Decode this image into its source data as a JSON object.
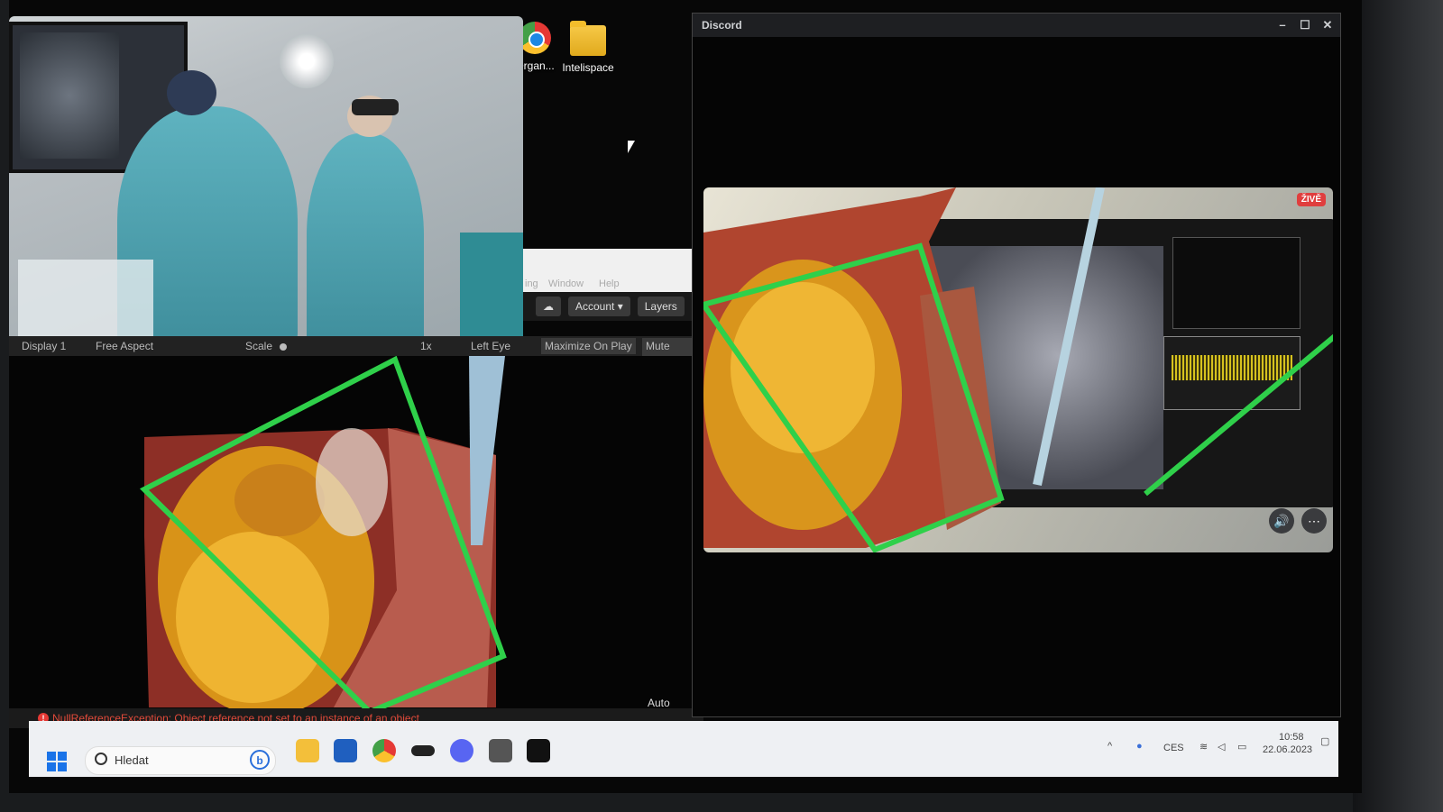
{
  "desktop": {
    "icons": [
      {
        "label": "Organ...",
        "icon": "chrome-icon"
      },
      {
        "label": "Intelispace",
        "icon": "folder-icon"
      }
    ]
  },
  "unity": {
    "menu": {
      "item1": "ing",
      "item2": "Window",
      "item3": "Help"
    },
    "toolbar": {
      "account": "Account",
      "layers": "Layers"
    },
    "game_bar": {
      "display": "Display 1",
      "aspect": "Free Aspect",
      "scale": "Scale",
      "zoom": "1x",
      "eye": "Left Eye",
      "maximize": "Maximize On Play",
      "mute": "Mute Audio"
    },
    "auto_generate": "Auto Genera",
    "error": "NullReferenceException: Object reference not set to an instance of an object"
  },
  "discord": {
    "title": "Discord",
    "live_badge": "ŽIVĚ"
  },
  "taskbar": {
    "search_placeholder": "Hledat",
    "language": "CES",
    "time": "10:58",
    "date": "22.06.2023"
  },
  "colors": {
    "overlay_green": "#2fd04a",
    "heart_gold": "#e8a21a",
    "tissue_red": "#a8443a",
    "live_red": "#e03e3e"
  }
}
